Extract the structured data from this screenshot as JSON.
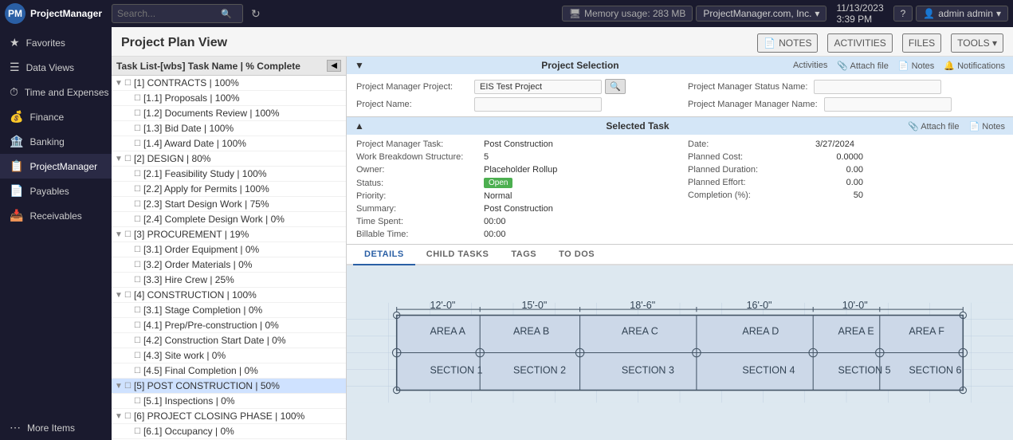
{
  "app": {
    "logo_text": "PM",
    "brand_name": "ProjectManager"
  },
  "topnav": {
    "search_placeholder": "Search...",
    "memory_label": "Memory usage: 283 MB",
    "company_name": "ProjectManager.com, Inc.",
    "date": "11/13/2023",
    "time": "3:39 PM",
    "help_label": "?",
    "user_label": "admin admin"
  },
  "sidebar": {
    "items": [
      {
        "id": "favorites",
        "label": "Favorites",
        "icon": "★"
      },
      {
        "id": "data-views",
        "label": "Data Views",
        "icon": "☰"
      },
      {
        "id": "time-expenses",
        "label": "Time and Expenses",
        "icon": "⏱"
      },
      {
        "id": "finance",
        "label": "Finance",
        "icon": "💰"
      },
      {
        "id": "banking",
        "label": "Banking",
        "icon": "🏦"
      },
      {
        "id": "project-manager",
        "label": "ProjectManager",
        "icon": "📋",
        "active": true
      },
      {
        "id": "payables",
        "label": "Payables",
        "icon": "📄"
      },
      {
        "id": "receivables",
        "label": "Receivables",
        "icon": "📥"
      },
      {
        "id": "more-items",
        "label": "More Items",
        "icon": "⋯"
      }
    ]
  },
  "page": {
    "title": "Project Plan View",
    "header_actions": [
      {
        "label": "NOTES",
        "icon": "📄"
      },
      {
        "label": "ACTIVITIES",
        "icon": ""
      },
      {
        "label": "FILES",
        "icon": ""
      },
      {
        "label": "TOOLS",
        "icon": ""
      }
    ]
  },
  "task_panel": {
    "header": "Task List-[wbs] Task Name | % Complete",
    "tasks": [
      {
        "level": 0,
        "label": "[1] CONTRACTS | 100%",
        "expandable": true
      },
      {
        "level": 1,
        "label": "[1.1] Proposals | 100%",
        "expandable": false
      },
      {
        "level": 1,
        "label": "[1.2] Documents Review | 100%",
        "expandable": false
      },
      {
        "level": 1,
        "label": "[1.3] Bid Date | 100%",
        "expandable": false
      },
      {
        "level": 1,
        "label": "[1.4] Award Date | 100%",
        "expandable": false
      },
      {
        "level": 0,
        "label": "[2] DESIGN | 80%",
        "expandable": true
      },
      {
        "level": 1,
        "label": "[2.1] Feasibility Study | 100%",
        "expandable": false
      },
      {
        "level": 1,
        "label": "[2.2] Apply for Permits | 100%",
        "expandable": false
      },
      {
        "level": 1,
        "label": "[2.3] Start Design Work | 75%",
        "expandable": false
      },
      {
        "level": 1,
        "label": "[2.4] Complete Design Work | 0%",
        "expandable": false
      },
      {
        "level": 0,
        "label": "[3] PROCUREMENT | 19%",
        "expandable": true
      },
      {
        "level": 1,
        "label": "[3.1] Order Equipment | 0%",
        "expandable": false
      },
      {
        "level": 1,
        "label": "[3.2] Order Materials | 0%",
        "expandable": false
      },
      {
        "level": 1,
        "label": "[3.3] Hire Crew | 25%",
        "expandable": false
      },
      {
        "level": 0,
        "label": "[4] CONSTRUCTION | 100%",
        "expandable": true
      },
      {
        "level": 1,
        "label": "[3.1] Stage Completion | 0%",
        "expandable": false
      },
      {
        "level": 1,
        "label": "[4.1] Prep/Pre-construction | 0%",
        "expandable": false
      },
      {
        "level": 1,
        "label": "[4.2] Construction Start Date | 0%",
        "expandable": false
      },
      {
        "level": 1,
        "label": "[4.3] Site work | 0%",
        "expandable": false
      },
      {
        "level": 1,
        "label": "[4.5] Final Completion | 0%",
        "expandable": false
      },
      {
        "level": 0,
        "label": "[5] POST CONSTRUCTION | 50%",
        "expandable": true,
        "selected": true
      },
      {
        "level": 1,
        "label": "[5.1] Inspections | 0%",
        "expandable": false
      },
      {
        "level": 0,
        "label": "[6] PROJECT CLOSING PHASE | 100%",
        "expandable": true
      },
      {
        "level": 1,
        "label": "[6.1] Occupancy | 0%",
        "expandable": false
      }
    ]
  },
  "project_selection": {
    "section_title": "Project Selection",
    "label_pm_project": "Project Manager Project:",
    "value_pm_project": "EIS Test Project",
    "label_project_name": "Project Name:",
    "label_pm_status": "Project Manager Status Name:",
    "label_pm_manager": "Project Manager Manager Name:",
    "side_actions": [
      {
        "label": "Activities"
      },
      {
        "label": "Attach file"
      },
      {
        "label": "Notes"
      },
      {
        "label": "Notifications"
      }
    ]
  },
  "selected_task": {
    "section_title": "Selected Task",
    "header_actions": [
      {
        "label": "Attach file"
      },
      {
        "label": "Notes"
      }
    ],
    "fields_left": [
      {
        "label": "Project Manager Task:",
        "value": "Post Construction"
      },
      {
        "label": "Work Breakdown Structure:",
        "value": "5"
      },
      {
        "label": "Owner:",
        "value": "Placeholder Rollup"
      },
      {
        "label": "Status:",
        "value": "Open",
        "badge": true
      },
      {
        "label": "Priority:",
        "value": "Normal"
      },
      {
        "label": "Summary:",
        "value": "Post Construction"
      },
      {
        "label": "Time Spent:",
        "value": "00:00"
      },
      {
        "label": "Billable Time:",
        "value": "00:00"
      }
    ],
    "fields_right": [
      {
        "label": "Date:",
        "value": "3/27/2024"
      },
      {
        "label": "Planned Cost:",
        "value": "0.0000"
      },
      {
        "label": "Planned Duration:",
        "value": "0.00"
      },
      {
        "label": "Planned Effort:",
        "value": "0.00"
      },
      {
        "label": "Completion (%):",
        "value": "50"
      }
    ]
  },
  "tabs": {
    "items": [
      {
        "id": "details",
        "label": "DETAILS",
        "active": true
      },
      {
        "id": "child-tasks",
        "label": "CHILD TASKS",
        "active": false
      },
      {
        "id": "tags",
        "label": "TAGS",
        "active": false
      },
      {
        "id": "to-dos",
        "label": "TO DOS",
        "active": false
      }
    ]
  }
}
